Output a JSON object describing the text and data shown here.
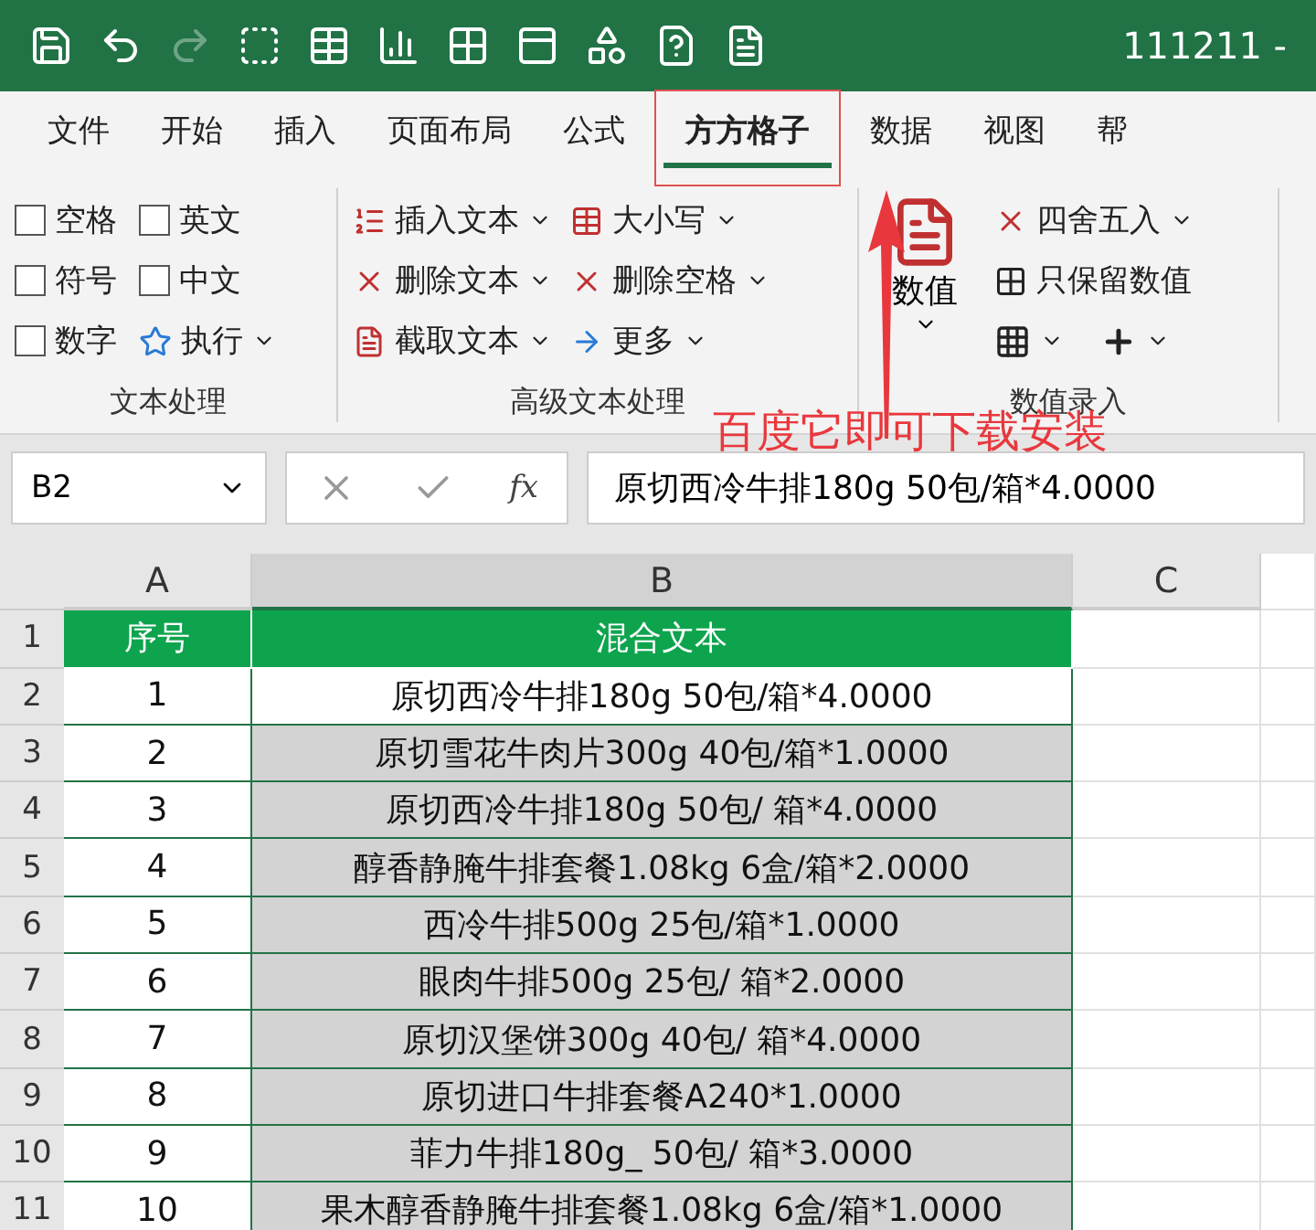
{
  "title_bar": {
    "title": "111211 -",
    "redo_enabled": false
  },
  "tabs": [
    {
      "label": "文件",
      "selected": false
    },
    {
      "label": "开始",
      "selected": false
    },
    {
      "label": "插入",
      "selected": false
    },
    {
      "label": "页面布局",
      "selected": false
    },
    {
      "label": "公式",
      "selected": false
    },
    {
      "label": "方方格子",
      "selected": true
    },
    {
      "label": "数据",
      "selected": false
    },
    {
      "label": "视图",
      "selected": false
    },
    {
      "label": "帮",
      "selected": false
    }
  ],
  "ribbon": {
    "groups": [
      {
        "kind": "checks",
        "label": "文本处理",
        "items": [
          {
            "kind": "checkbox",
            "label": "空格",
            "checked": false
          },
          {
            "kind": "checkbox",
            "label": "英文",
            "checked": false
          },
          {
            "kind": "checkbox",
            "label": "符号",
            "checked": false
          },
          {
            "kind": "checkbox",
            "label": "中文",
            "checked": false
          },
          {
            "kind": "checkbox",
            "label": "数字",
            "checked": false
          },
          {
            "kind": "menu",
            "label": "执行"
          }
        ]
      },
      {
        "kind": "columns",
        "label": "高级文本处理",
        "items": [
          {
            "kind": "menu",
            "label": "插入文本"
          },
          {
            "kind": "menu",
            "label": "删除文本"
          },
          {
            "kind": "menu",
            "label": "截取文本"
          },
          {
            "kind": "menu",
            "label": "大小写"
          },
          {
            "kind": "menu",
            "label": "删除空格"
          },
          {
            "kind": "menu",
            "label": "更多"
          }
        ]
      },
      {
        "kind": "value",
        "label": "数值录入",
        "items": [
          {
            "kind": "big",
            "label": "数值"
          },
          {
            "kind": "menu",
            "label": "四舍五入"
          },
          {
            "kind": "plain",
            "label": "只保留数值"
          },
          {
            "kind": "icon_menu"
          },
          {
            "kind": "icon_menu"
          }
        ]
      }
    ]
  },
  "annotation": {
    "text": "百度它即可下载安装"
  },
  "formula_bar": {
    "name_box": "B2",
    "function_label": "fx",
    "formula": "原切西冷牛排180g 50包/箱*4.0000"
  },
  "sheet": {
    "columns": [
      {
        "label": "A",
        "selected": false
      },
      {
        "label": "B",
        "selected": true
      },
      {
        "label": "C",
        "selected": false
      }
    ],
    "header": {
      "row": "1",
      "cells": [
        "序号",
        "混合文本"
      ]
    },
    "rows": [
      {
        "row": "2",
        "no": "1",
        "text": "原切西冷牛排180g 50包/箱*4.0000",
        "highlighted": false
      },
      {
        "row": "3",
        "no": "2",
        "text": "原切雪花牛肉片300g 40包/箱*1.0000",
        "highlighted": true
      },
      {
        "row": "4",
        "no": "3",
        "text": "原切西冷牛排180g 50包/ 箱*4.0000",
        "highlighted": true
      },
      {
        "row": "5",
        "no": "4",
        "text": "醇香静腌牛排套餐1.08kg 6盒/箱*2.0000",
        "highlighted": true
      },
      {
        "row": "6",
        "no": "5",
        "text": "西冷牛排500g 25包/箱*1.0000",
        "highlighted": true
      },
      {
        "row": "7",
        "no": "6",
        "text": "眼肉牛排500g 25包/ 箱*2.0000",
        "highlighted": true
      },
      {
        "row": "8",
        "no": "7",
        "text": "原切汉堡饼300g 40包/ 箱*4.0000",
        "highlighted": true
      },
      {
        "row": "9",
        "no": "8",
        "text": "原切进口牛排套餐A240*1.0000",
        "highlighted": true
      },
      {
        "row": "10",
        "no": "9",
        "text": "菲力牛排180g_ 50包/ 箱*3.0000",
        "highlighted": true
      },
      {
        "row": "11",
        "no": "10",
        "text": "果木醇香静腌牛排套餐1.08kg 6盒/箱*1.0000",
        "highlighted": true
      }
    ]
  }
}
